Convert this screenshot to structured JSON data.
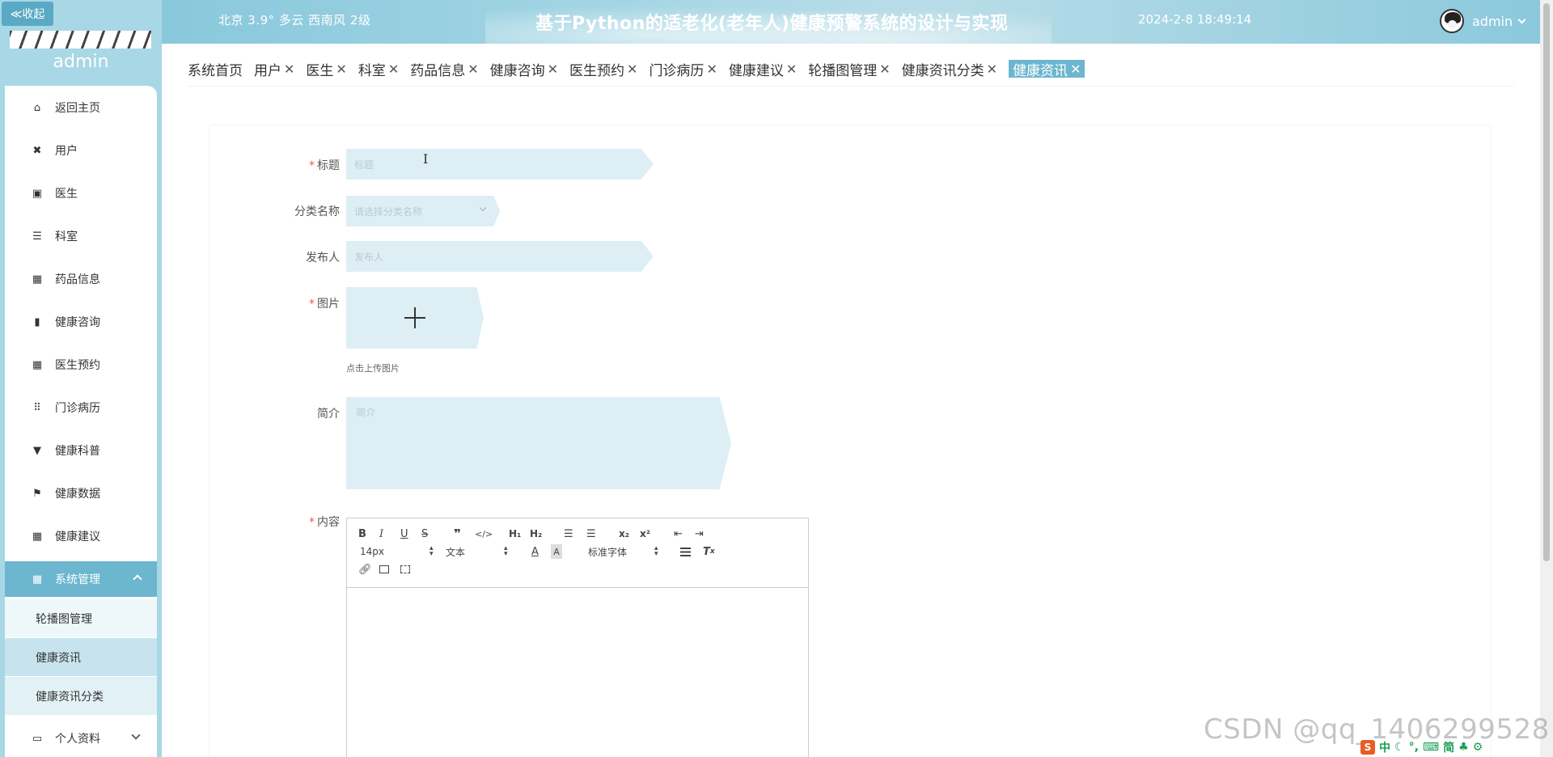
{
  "header": {
    "collapse_label": "≪收起",
    "weather": "北京  3.9°  多云  西南风  2级",
    "title": "基于Python的适老化(老年人)健康预警系统的设计与实现",
    "datetime": "2024-2-8 18:49:14",
    "username": "admin"
  },
  "sidebar": {
    "username": "admin",
    "items": [
      {
        "label": "返回主页",
        "icon": "⌂",
        "icon_name": "home-icon"
      },
      {
        "label": "用户",
        "icon": "✖",
        "icon_name": "user-icon"
      },
      {
        "label": "医生",
        "icon": "▣",
        "icon_name": "doctor-icon"
      },
      {
        "label": "科室",
        "icon": "☰",
        "icon_name": "list-icon"
      },
      {
        "label": "药品信息",
        "icon": "▦",
        "icon_name": "grid-icon"
      },
      {
        "label": "健康咨询",
        "icon": "▮",
        "icon_name": "chart-icon"
      },
      {
        "label": "医生预约",
        "icon": "▦",
        "icon_name": "grid-icon"
      },
      {
        "label": "门诊病历",
        "icon": "⠿",
        "icon_name": "grid-icon"
      },
      {
        "label": "健康科普",
        "icon": "▼",
        "icon_name": "brush-icon"
      },
      {
        "label": "健康数据",
        "icon": "⚑",
        "icon_name": "flag-icon"
      },
      {
        "label": "健康建议",
        "icon": "▦",
        "icon_name": "grid-icon"
      }
    ],
    "system": {
      "label": "系统管理",
      "icon": "▦"
    },
    "sub_items": [
      "轮播图管理",
      "健康资讯",
      "健康资讯分类"
    ],
    "profile": {
      "label": "个人资料",
      "icon": "▭"
    }
  },
  "tabs": [
    {
      "label": "系统首页",
      "closable": false
    },
    {
      "label": "用户",
      "closable": true
    },
    {
      "label": "医生",
      "closable": true
    },
    {
      "label": "科室",
      "closable": true
    },
    {
      "label": "药品信息",
      "closable": true
    },
    {
      "label": "健康咨询",
      "closable": true
    },
    {
      "label": "医生预约",
      "closable": true
    },
    {
      "label": "门诊病历",
      "closable": true
    },
    {
      "label": "健康建议",
      "closable": true
    },
    {
      "label": "轮播图管理",
      "closable": true
    },
    {
      "label": "健康资讯分类",
      "closable": true
    },
    {
      "label": "健康资讯",
      "closable": true,
      "active": true
    }
  ],
  "form": {
    "title_label": "标题",
    "title_placeholder": "标题",
    "category_label": "分类名称",
    "category_placeholder": "请选择分类名称",
    "publisher_label": "发布人",
    "publisher_placeholder": "发布人",
    "image_label": "图片",
    "upload_hint": "点击上传图片",
    "intro_label": "简介",
    "intro_placeholder": "简介",
    "content_label": "内容"
  },
  "editor": {
    "font_size": "14px",
    "header_select": "文本",
    "font_family": "标准字体"
  },
  "watermark": "CSDN @qq_1406299528",
  "ime": {
    "lang": "中",
    "mode": "简"
  },
  "colors": {
    "accent": "#6cb6cf",
    "sidebar_bg": "#a8d7e6",
    "input_bg": "#ddeff5"
  }
}
